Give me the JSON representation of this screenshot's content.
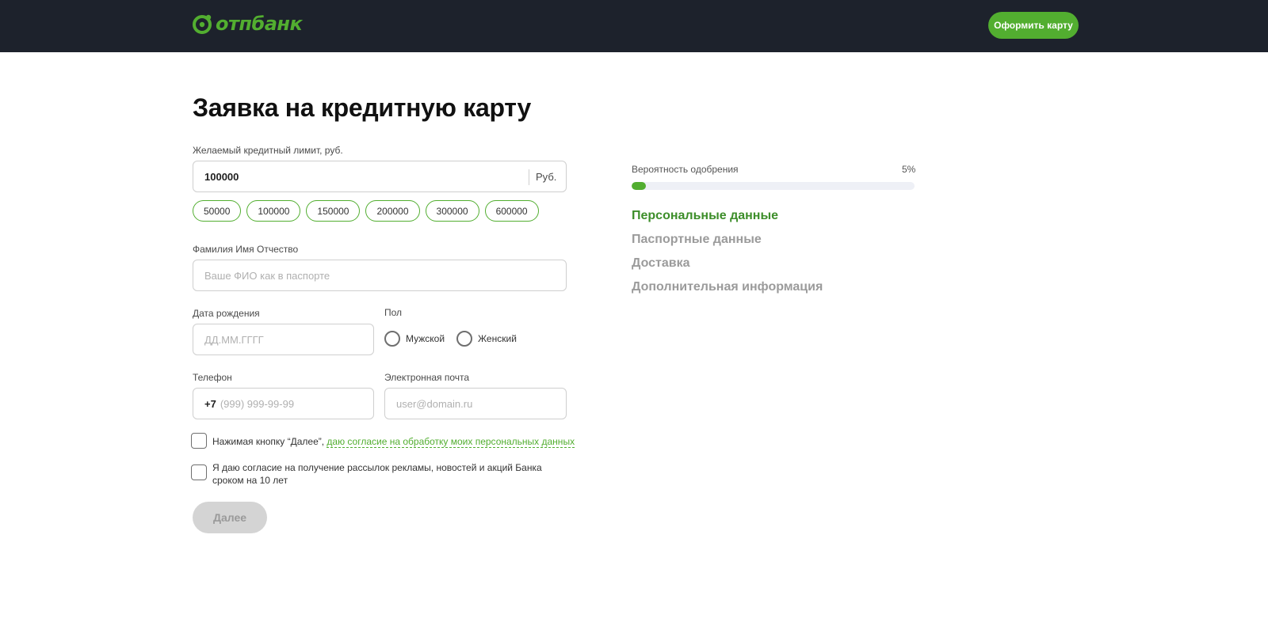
{
  "header": {
    "logo_text": "отпбанк",
    "cta_label": "Оформить карту",
    "brand_color": "#52ae30",
    "bg_color": "#1d222c"
  },
  "form": {
    "title": "Заявка на кредитную карту",
    "limit": {
      "label": "Желаемый кредитный лимит, руб.",
      "value": "100000",
      "unit": "Руб.",
      "chips": [
        "50000",
        "100000",
        "150000",
        "200000",
        "300000",
        "600000"
      ]
    },
    "fio": {
      "label": "Фамилия Имя Отчество",
      "placeholder": "Ваше ФИО как в паспорте",
      "value": ""
    },
    "dob": {
      "label": "Дата рождения",
      "placeholder": "ДД.ММ.ГГГГ",
      "value": ""
    },
    "gender": {
      "label": "Пол",
      "options": [
        "Мужской",
        "Женский"
      ]
    },
    "phone": {
      "label": "Телефон",
      "prefix": "+7",
      "placeholder": "(999) 999-99-99",
      "value": ""
    },
    "email": {
      "label": "Электронная почта",
      "placeholder": "user@domain.ru",
      "value": ""
    },
    "consent1": {
      "text": "Нажимая кнопку “Далее”, ",
      "link": "даю согласие на обработку моих персональных данных",
      "checked": false
    },
    "consent2": {
      "text": "Я даю согласие на получение рассылок рекламы, новостей и акций Банка сроком на 10 лет",
      "checked": false
    },
    "next_label": "Далее"
  },
  "sidebar": {
    "probability_label": "Вероятность одобрения",
    "probability_value": "5%",
    "probability_fraction": 0.05,
    "steps": [
      {
        "label": "Персональные данные",
        "active": true
      },
      {
        "label": "Паспортные данные",
        "active": false
      },
      {
        "label": "Доставка",
        "active": false
      },
      {
        "label": "Дополнительная информация",
        "active": false
      }
    ]
  }
}
